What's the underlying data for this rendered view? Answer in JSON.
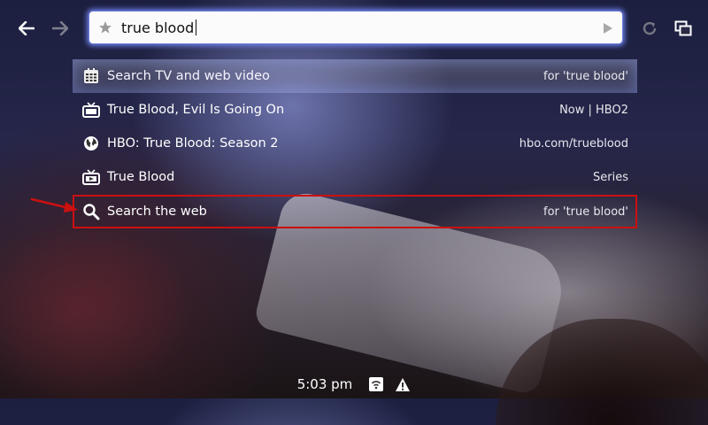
{
  "navigation": {
    "back_icon": "arrow-left-icon",
    "forward_icon": "arrow-right-icon",
    "refresh_icon": "refresh-icon",
    "windows_icon": "windows-icon"
  },
  "omnibox": {
    "value": "true blood",
    "star_icon": "star-icon",
    "go_icon": "play-icon"
  },
  "suggestions": [
    {
      "icon": "tv-guide-icon",
      "label": "Search TV and web video",
      "context": "for 'true blood'"
    },
    {
      "icon": "tv-icon",
      "label": "True Blood, Evil Is Going On",
      "context": "Now | HBO2"
    },
    {
      "icon": "globe-icon",
      "label": "HBO: True Blood: Season 2",
      "context": "hbo.com/trueblood"
    },
    {
      "icon": "tv-series-icon",
      "label": "True Blood",
      "context": "Series"
    },
    {
      "icon": "search-icon",
      "label": "Search the web",
      "context": "for 'true blood'"
    }
  ],
  "statusbar": {
    "time": "5:03 pm",
    "network_icon": "network-icon",
    "warning_icon": "warning-icon"
  },
  "colors": {
    "highlight_border": "#cc1010",
    "annotation_arrow": "#cc1010",
    "omnibox_glow": "#7890ff"
  }
}
